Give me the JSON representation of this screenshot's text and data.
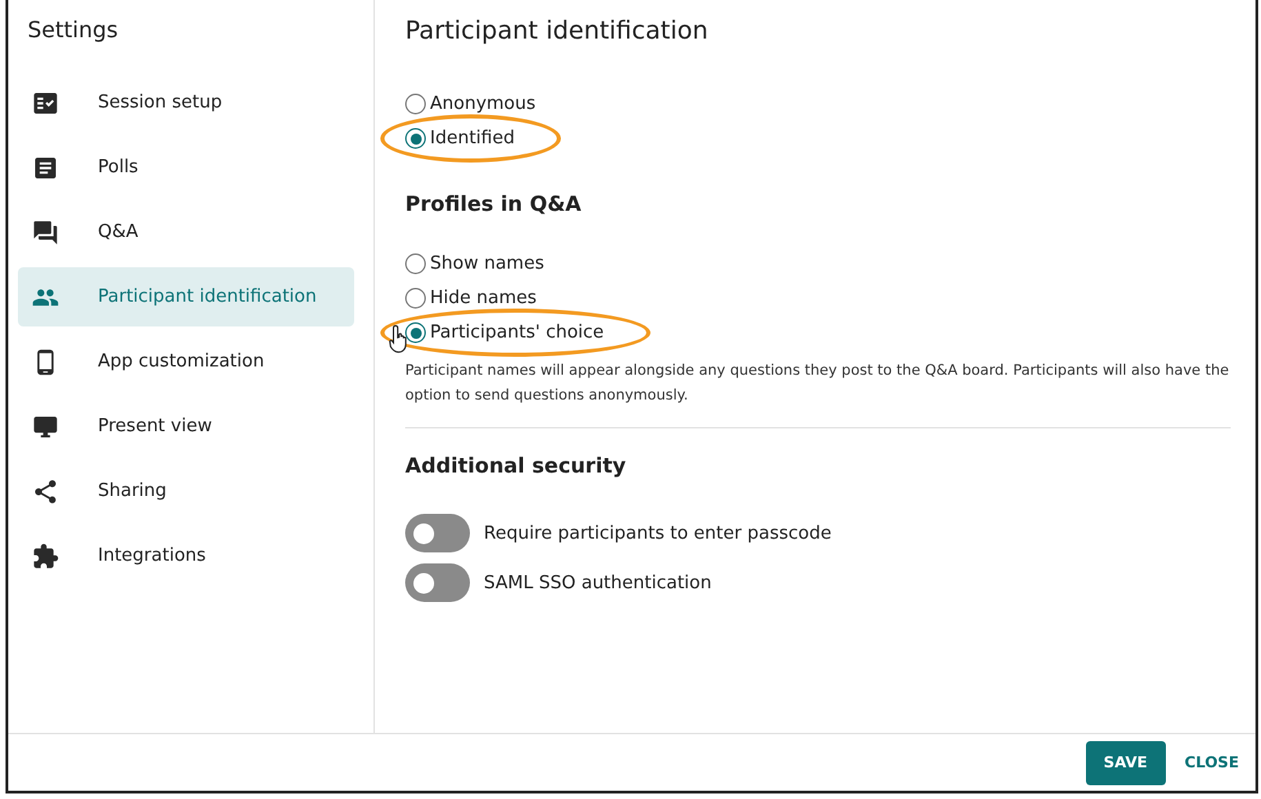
{
  "sidebar": {
    "title": "Settings",
    "items": [
      {
        "label": "Session setup",
        "selected": false
      },
      {
        "label": "Polls",
        "selected": false
      },
      {
        "label": "Q&A",
        "selected": false
      },
      {
        "label": "Participant identification",
        "selected": true
      },
      {
        "label": "App customization",
        "selected": false
      },
      {
        "label": "Present view",
        "selected": false
      },
      {
        "label": "Sharing",
        "selected": false
      },
      {
        "label": "Integrations",
        "selected": false
      }
    ]
  },
  "main": {
    "title": "Participant identification",
    "identification": [
      {
        "label": "Anonymous",
        "selected": false,
        "highlighted": false
      },
      {
        "label": "Identified",
        "selected": true,
        "highlighted": true
      }
    ],
    "profiles": {
      "title": "Profiles in Q&A",
      "options": [
        {
          "label": "Show names",
          "selected": false,
          "highlighted": false
        },
        {
          "label": "Hide names",
          "selected": false,
          "highlighted": false
        },
        {
          "label": "Participants' choice",
          "selected": true,
          "highlighted": true
        }
      ],
      "description": "Participant names will appear alongside any questions they post to the Q&A board. Participants will also have the option to send questions anonymously."
    },
    "security": {
      "title": "Additional security",
      "toggles": [
        {
          "label": "Require participants to enter passcode",
          "on": false
        },
        {
          "label": "SAML SSO authentication",
          "on": false
        }
      ]
    }
  },
  "footer": {
    "save": "SAVE",
    "close": "CLOSE"
  }
}
